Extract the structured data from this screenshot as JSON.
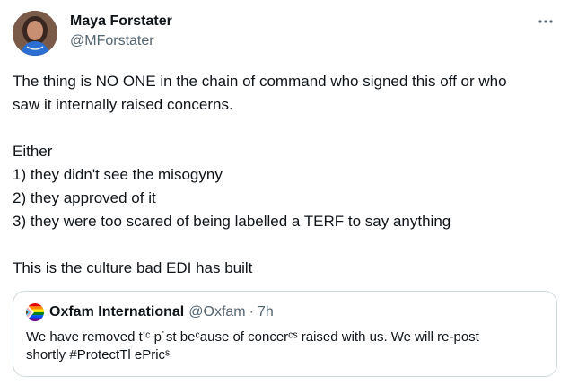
{
  "author": {
    "display_name": "Maya Forstater",
    "handle": "@MForstater"
  },
  "tweet": {
    "lines": [
      "The thing is NO ONE in the chain of command who signed this off or who",
      "saw it internally raised concerns.",
      "",
      "Either",
      "1) they didn't see the misogyny",
      "2) they approved of it",
      "3) they were too scared of being labelled a TERF to say anything",
      "",
      "This is the culture bad EDI has built"
    ]
  },
  "quote": {
    "display_name": "Oxfam International",
    "handle": "@Oxfam",
    "separator": "·",
    "time": "7h",
    "lines": [
      "We have removed t’ᶜ p˙st beᶜause of concerᶜˢ raised with us. We will re-post",
      "shortly #ProtectTl ePricˢ"
    ]
  },
  "icons": {
    "more": "more-horizontal-icon",
    "quote_avatar": "rainbow-flag-avatar"
  },
  "colors": {
    "text": "#0f1419",
    "secondary": "#536471",
    "border": "#cfd9de"
  }
}
